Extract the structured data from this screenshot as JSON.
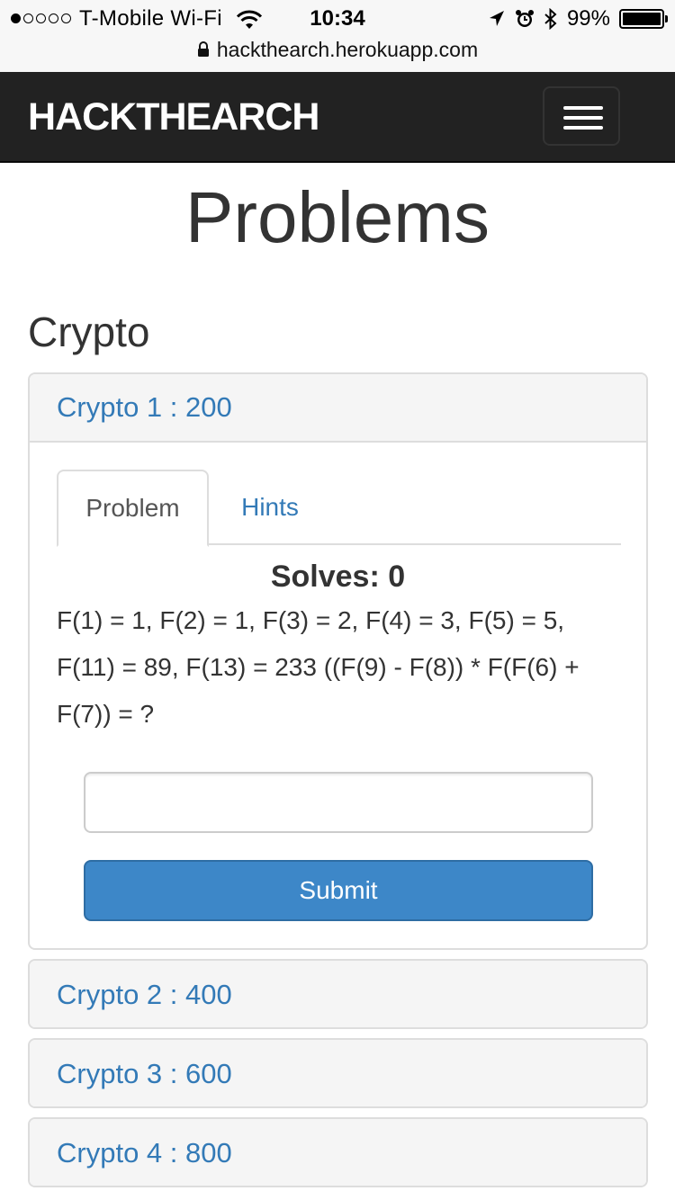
{
  "status_bar": {
    "carrier": "T-Mobile Wi-Fi",
    "time": "10:34",
    "battery": "99%",
    "battery_level": 0.99,
    "url": "hackthearch.herokuapp.com",
    "signal_bars_filled": 1,
    "icons": [
      "signal-icon",
      "wifi-icon",
      "location-arrow-icon",
      "alarm-icon",
      "bluetooth-icon",
      "battery-icon",
      "lock-icon"
    ]
  },
  "navbar": {
    "brand": "HACKTHEARCH",
    "toggle_icon": "hamburger-menu-icon"
  },
  "page": {
    "title": "Problems",
    "section": "Crypto"
  },
  "problems": [
    {
      "label": "Crypto 1 : 200",
      "expanded": true,
      "tabs": [
        "Problem",
        "Hints"
      ],
      "active_tab": "Problem",
      "solves": "Solves: 0",
      "text": "F(1) = 1, F(2) = 1, F(3) = 2, F(4) = 3, F(5) = 5, F(11) = 89, F(13) = 233 ((F(9) - F(8)) * F(F(6) + F(7)) = ?",
      "answer_value": "",
      "submit_label": "Submit"
    },
    {
      "label": "Crypto 2 : 400",
      "expanded": false
    },
    {
      "label": "Crypto 3 : 600",
      "expanded": false
    },
    {
      "label": "Crypto 4 : 800",
      "expanded": false
    }
  ],
  "colors": {
    "navbar_bg": "#222222",
    "link_blue": "#337ab7",
    "button_blue": "#3d87c8",
    "panel_heading_bg": "#f5f5f5"
  }
}
